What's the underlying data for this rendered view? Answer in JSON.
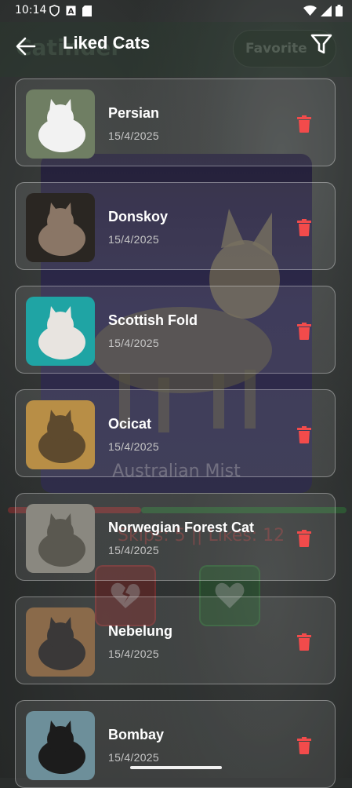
{
  "status_bar": {
    "time": "10:14",
    "left_icons": [
      "shield-icon",
      "font-app-icon",
      "sd-card-icon"
    ],
    "right_icons": [
      "wifi-icon",
      "signal-icon",
      "battery-icon"
    ]
  },
  "app_bar": {
    "title": "Liked Cats",
    "back_icon": "arrow-left-icon",
    "filter_icon": "filter-icon"
  },
  "background": {
    "caption": "Australian Mist",
    "stats": "Skips: 5 || Likes: 12",
    "favorite_label": "Favorite",
    "title_partial": "Catinder"
  },
  "liked_cats": [
    {
      "name": "Persian",
      "date": "15/4/2025",
      "colors": [
        "#6f7e63",
        "#f2f2f2"
      ]
    },
    {
      "name": "Donskoy",
      "date": "15/4/2025",
      "colors": [
        "#2a2622",
        "#8a7666"
      ]
    },
    {
      "name": "Scottish Fold",
      "date": "15/4/2025",
      "colors": [
        "#1fa4a4",
        "#e8e4e0"
      ]
    },
    {
      "name": "Ocicat",
      "date": "15/4/2025",
      "colors": [
        "#b88e46",
        "#5e4a2e"
      ]
    },
    {
      "name": "Norwegian Forest Cat",
      "date": "15/4/2025",
      "colors": [
        "#8a8880",
        "#5a5850"
      ]
    },
    {
      "name": "Nebelung",
      "date": "15/4/2025",
      "colors": [
        "#8a6a4a",
        "#3a3838"
      ]
    },
    {
      "name": "Bombay",
      "date": "15/4/2025",
      "colors": [
        "#6d8f9a",
        "#1c1c1c"
      ]
    }
  ],
  "colors": {
    "delete": "#f24b4b",
    "card_border": "#8b8f8e"
  }
}
